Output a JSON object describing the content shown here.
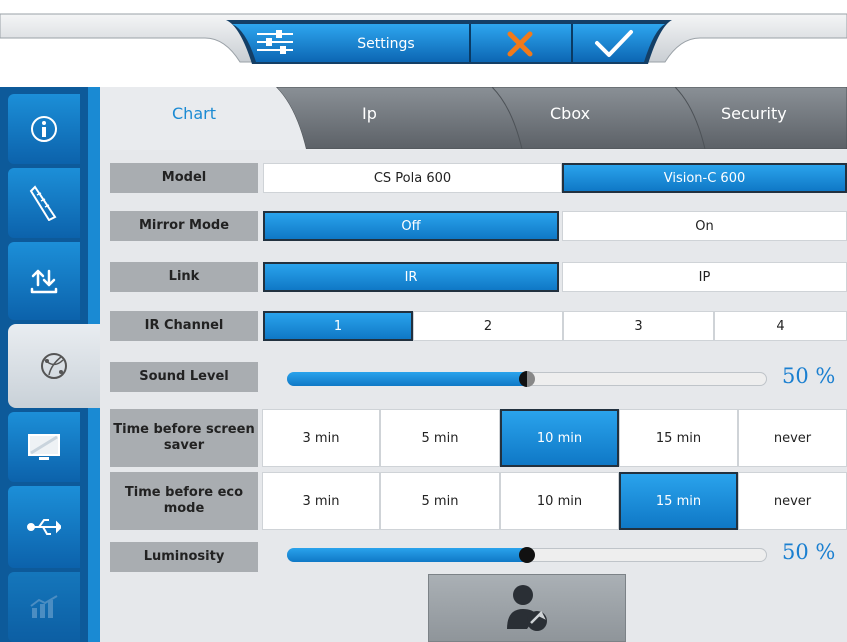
{
  "topbar": {
    "settings_label": "Settings",
    "settings_icon": "sliders-icon",
    "cancel_icon": "close-x-icon",
    "confirm_icon": "checkmark-icon"
  },
  "sidebar": {
    "items": [
      {
        "name": "info-icon"
      },
      {
        "name": "ruler-icon"
      },
      {
        "name": "transfer-icon"
      },
      {
        "name": "network-globe-icon"
      },
      {
        "name": "monitor-icon"
      },
      {
        "name": "usb-icon"
      },
      {
        "name": "chart-icon"
      }
    ]
  },
  "tabs": [
    "Chart",
    "Ip",
    "Cbox",
    "Security"
  ],
  "active_tab": "Chart",
  "settings": {
    "model": {
      "label": "Model",
      "options": [
        "CS Pola 600",
        "Vision-C 600"
      ],
      "selected": "Vision-C 600"
    },
    "mirror_mode": {
      "label": "Mirror Mode",
      "options": [
        "Off",
        "On"
      ],
      "selected": "Off"
    },
    "link": {
      "label": "Link",
      "options": [
        "IR",
        "IP"
      ],
      "selected": "IR"
    },
    "ir_channel": {
      "label": "IR Channel",
      "options": [
        "1",
        "2",
        "3",
        "4"
      ],
      "selected": "1"
    },
    "sound_level": {
      "label": "Sound Level",
      "value": 50,
      "display": "50 %"
    },
    "screen_saver": {
      "label": "Time before screen saver",
      "options": [
        "3 min",
        "5 min",
        "10 min",
        "15 min",
        "never"
      ],
      "selected": "10 min"
    },
    "eco_mode": {
      "label": "Time before eco mode",
      "options": [
        "3 min",
        "5 min",
        "10 min",
        "15 min",
        "never"
      ],
      "selected": "15 min"
    },
    "luminosity": {
      "label": "Luminosity",
      "value": 50,
      "display": "50 %"
    }
  },
  "action_button_icon": "user-wrench-icon",
  "colors": {
    "accent": "#1a8ad3",
    "sidebar": "#0d5a9a",
    "selected": "#1583d2"
  }
}
